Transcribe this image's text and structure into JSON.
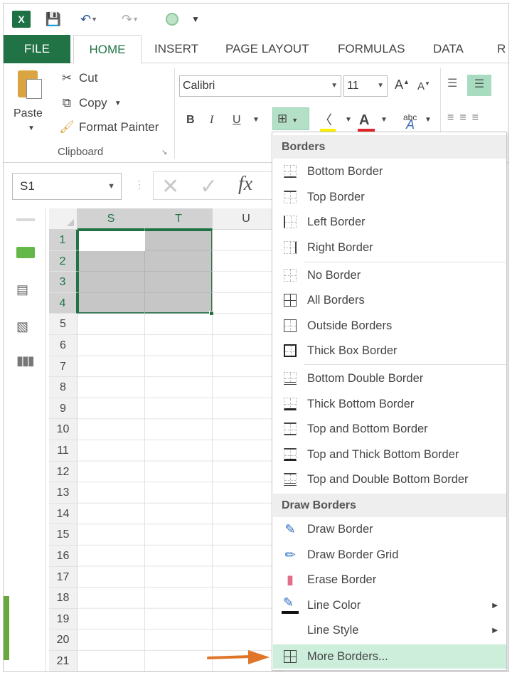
{
  "qat": {
    "app_icon": "excel-logo-icon",
    "app_logo_text": "X",
    "save_icon": "save-icon",
    "undo_icon": "undo-icon",
    "redo_icon": "redo-icon",
    "touch_icon": "touch-mode-icon",
    "customize_icon": "customize-qat-icon"
  },
  "tabs": [
    "FILE",
    "HOME",
    "INSERT",
    "PAGE LAYOUT",
    "FORMULAS",
    "DATA",
    "R"
  ],
  "clipboard": {
    "paste": "Paste",
    "cut": "Cut",
    "copy": "Copy",
    "format_painter": "Format Painter",
    "group_label": "Clipboard"
  },
  "font": {
    "name": "Calibri",
    "size": "11",
    "bold": "B",
    "italic": "I",
    "underline": "U",
    "font_color_letter": "A",
    "grow": "A",
    "shrink": "A",
    "abc": "abc"
  },
  "formula_bar": {
    "name_box": "S1",
    "fx": "fx",
    "value": ""
  },
  "grid": {
    "columns": [
      "S",
      "T",
      "U"
    ],
    "rows": [
      "1",
      "2",
      "3",
      "4",
      "5",
      "6",
      "7",
      "8",
      "9",
      "10",
      "11",
      "12",
      "13",
      "14",
      "15",
      "16",
      "17",
      "18",
      "19",
      "20",
      "21"
    ],
    "selection": "S1:T4"
  },
  "menu": {
    "borders_header": "Borders",
    "draw_header": "Draw Borders",
    "items": [
      {
        "label": "Bottom Border",
        "icon": "bottom-border-icon"
      },
      {
        "label": "Top Border",
        "icon": "top-border-icon"
      },
      {
        "label": "Left Border",
        "icon": "left-border-icon"
      },
      {
        "label": "Right Border",
        "icon": "right-border-icon"
      },
      {
        "label": "No Border",
        "icon": "no-border-icon"
      },
      {
        "label": "All Borders",
        "icon": "all-borders-icon"
      },
      {
        "label": "Outside Borders",
        "icon": "outside-borders-icon"
      },
      {
        "label": "Thick Box Border",
        "icon": "thick-box-border-icon"
      },
      {
        "label": "Bottom Double Border",
        "icon": "bottom-double-border-icon"
      },
      {
        "label": "Thick Bottom Border",
        "icon": "thick-bottom-border-icon"
      },
      {
        "label": "Top and Bottom Border",
        "icon": "top-bottom-border-icon"
      },
      {
        "label": "Top and Thick Bottom Border",
        "icon": "top-thick-bottom-border-icon"
      },
      {
        "label": "Top and Double Bottom Border",
        "icon": "top-double-bottom-border-icon"
      }
    ],
    "draw_items": [
      {
        "label": "Draw Border",
        "icon": "draw-border-icon"
      },
      {
        "label": "Draw Border Grid",
        "icon": "draw-border-grid-icon"
      },
      {
        "label": "Erase Border",
        "icon": "eraser-icon"
      },
      {
        "label": "Line Color",
        "icon": "line-color-icon"
      },
      {
        "label": "Line Style",
        "icon": ""
      },
      {
        "label": "More Borders...",
        "icon": "more-borders-icon"
      }
    ]
  },
  "colors": {
    "accent": "#217346",
    "menu_highlight": "#cdeedb",
    "pointer_arrow": "#e0752a"
  }
}
